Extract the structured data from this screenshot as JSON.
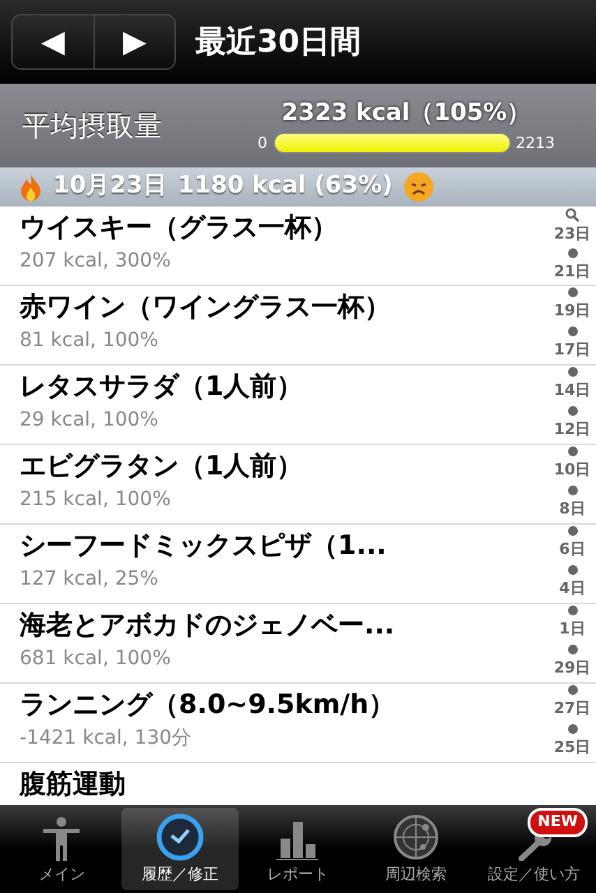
{
  "nav": {
    "prev": "◀",
    "next": "▶",
    "title": "最近30日間"
  },
  "summary": {
    "label": "平均摂取量",
    "value": "2323 kcal（105%）",
    "min": "0",
    "max": "2213",
    "level": 1.0
  },
  "day_header": {
    "date": "10月23日",
    "total": "1180 kcal (63%)"
  },
  "entries": [
    {
      "name": "ウイスキー（グラス一杯）",
      "detail": "207 kcal, 300%",
      "index": [
        "23日",
        "21日"
      ]
    },
    {
      "name": "赤ワイン（ワイングラス一杯）",
      "detail": "81 kcal, 100%",
      "index": [
        "19日",
        "17日"
      ]
    },
    {
      "name": "レタスサラダ（1人前）",
      "detail": "29 kcal, 100%",
      "index": [
        "14日",
        "12日"
      ]
    },
    {
      "name": "エビグラタン（1人前）",
      "detail": "215 kcal, 100%",
      "index": [
        "10日",
        "8日"
      ]
    },
    {
      "name": "シーフードミックスピザ（1...",
      "detail": "127 kcal, 25%",
      "index": [
        "6日",
        "4日"
      ]
    },
    {
      "name": "海老とアボカドのジェノベー...",
      "detail": "681 kcal, 100%",
      "index": [
        "1日",
        "29日"
      ]
    },
    {
      "name": "ランニング（8.0~9.5km/h）",
      "detail": "-1421 kcal, 130分",
      "index": [
        "27日",
        "25日"
      ]
    },
    {
      "name": "腹筋運動"
    }
  ],
  "tabs": [
    {
      "label": "メイン",
      "kind": "person",
      "selected": false
    },
    {
      "label": "履歴／修正",
      "kind": "clock",
      "selected": true
    },
    {
      "label": "レポート",
      "kind": "chart",
      "selected": false
    },
    {
      "label": "周辺検索",
      "kind": "radar",
      "selected": false
    },
    {
      "label": "設定／使い方",
      "kind": "wrench",
      "selected": false,
      "badge": "NEW"
    }
  ]
}
